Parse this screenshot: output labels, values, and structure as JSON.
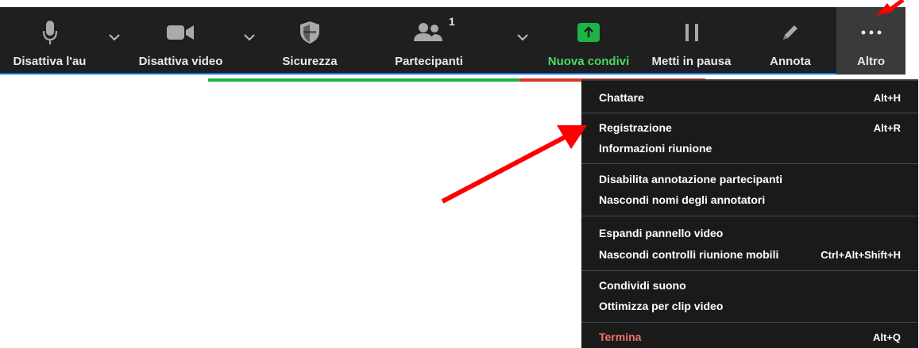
{
  "toolbar": {
    "mute": "Disattiva l'au",
    "video": "Disattiva video",
    "security": "Sicurezza",
    "participants": "Partecipanti",
    "participants_count": "1",
    "share": "Nuova condivi",
    "pause": "Metti in pausa",
    "annotate": "Annota",
    "more": "Altro"
  },
  "menu": {
    "chat": {
      "label": "Chattare",
      "shortcut": "Alt+H"
    },
    "record": {
      "label": "Registrazione",
      "shortcut": "Alt+R"
    },
    "meeting_info": {
      "label": "Informazioni riunione"
    },
    "disable_annotation": {
      "label": "Disabilita annotazione partecipanti"
    },
    "hide_annotators": {
      "label": "Nascondi nomi degli annotatori"
    },
    "expand_video": {
      "label": "Espandi pannello video"
    },
    "hide_controls": {
      "label": "Nascondi controlli riunione mobili",
      "shortcut": "Ctrl+Alt+Shift+H"
    },
    "share_sound": {
      "label": "Condividi suono"
    },
    "optimize_video": {
      "label": "Ottimizza per clip video"
    },
    "end": {
      "label": "Termina",
      "shortcut": "Alt+Q"
    }
  },
  "colors": {
    "toolbar_bg": "#1f1f1f",
    "menu_bg": "#1a1a1a",
    "share_green": "#1bb445",
    "end_red": "#f0736a",
    "annotation_arrow": "#ff0000"
  },
  "icons": [
    "microphone-icon",
    "camera-icon",
    "shield-icon",
    "participants-icon",
    "share-screen-icon",
    "pause-icon",
    "pencil-icon",
    "more-dots-icon",
    "chevron-down-icon"
  ]
}
